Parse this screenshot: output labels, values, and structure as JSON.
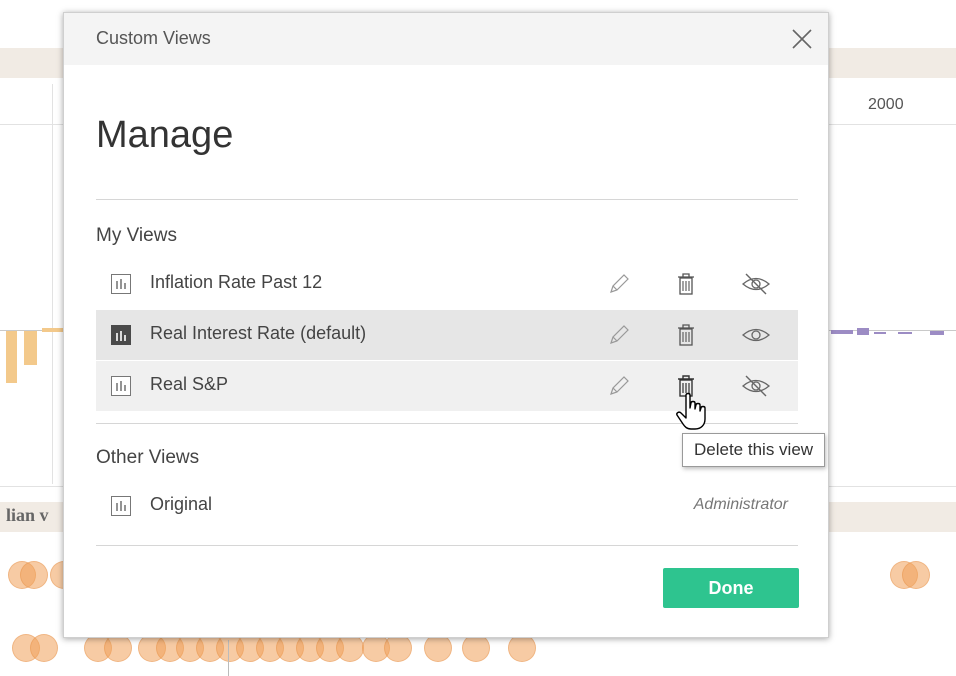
{
  "background": {
    "year_label": "2000",
    "partial_label": "lian v"
  },
  "dialog": {
    "title": "Custom Views",
    "heading": "Manage",
    "my_views_label": "My Views",
    "my_views": [
      {
        "name": "Inflation Rate Past 12",
        "state": "normal",
        "visibility": "hidden"
      },
      {
        "name": "Real Interest Rate (default)",
        "state": "selected",
        "visibility": "visible"
      },
      {
        "name": "Real S&P",
        "state": "hover",
        "visibility": "hidden"
      }
    ],
    "other_views_label": "Other Views",
    "other_views": [
      {
        "name": "Original",
        "owner": "Administrator"
      }
    ],
    "done_label": "Done",
    "tooltip": "Delete this view"
  },
  "colors": {
    "done": "#2ec48f",
    "selected_row": "#e6e6e6",
    "hover_row": "#f0f0f0"
  }
}
